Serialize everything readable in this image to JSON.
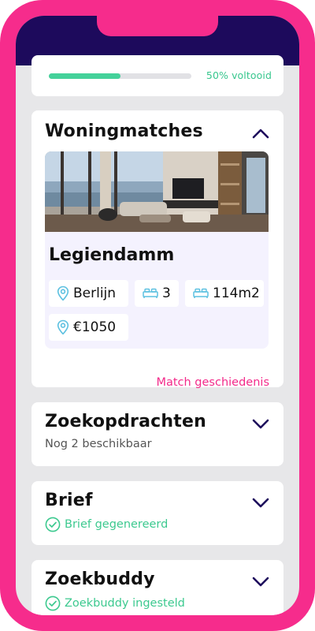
{
  "progress": {
    "value": 0.5,
    "label": "50% voltooid",
    "color": "#44d19a"
  },
  "matches": {
    "title": "Woningmatches",
    "expanded": true,
    "listing": {
      "name": "Legiendamm",
      "city": "Berlijn",
      "bedrooms": "3",
      "area": "114m2",
      "price": "€1050"
    },
    "history_link": "Match geschiedenis"
  },
  "search": {
    "title": "Zoekopdrachten",
    "subtitle": "Nog 2 beschikbaar"
  },
  "letter": {
    "title": "Brief",
    "status": "Brief gegenereerd"
  },
  "buddy": {
    "title": "Zoekbuddy",
    "status": "Zoekbuddy ingesteld"
  },
  "colors": {
    "accent": "#f62c8c",
    "header": "#1d0a5c",
    "success": "#3cc98f"
  },
  "icons": [
    "chevron-up-icon",
    "chevron-down-icon",
    "location-pin-icon",
    "bed-icon",
    "check-circle-icon"
  ]
}
